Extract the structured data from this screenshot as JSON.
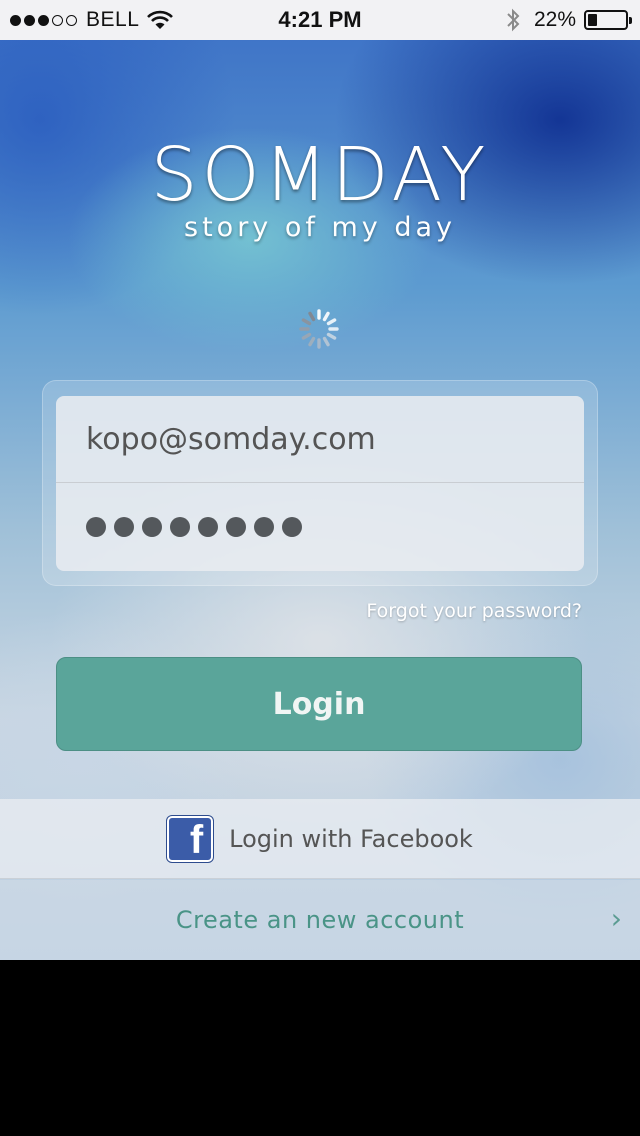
{
  "status_bar": {
    "carrier": "BELL",
    "time": "4:21 PM",
    "battery_percent": "22%",
    "signal_bars_filled": 3,
    "signal_bars_total": 5,
    "battery_level": 0.22
  },
  "brand": {
    "logo": "SOMDAY",
    "tagline": "story of my day"
  },
  "form": {
    "email_value": "kopo@somday.com",
    "password_length": 8,
    "forgot_link": "Forgot your password?",
    "login_button": "Login"
  },
  "social": {
    "facebook_label": "Login with Facebook",
    "facebook_glyph": "f"
  },
  "signup": {
    "create_account_label": "Create an new account",
    "chevron": "›"
  },
  "colors": {
    "login_button": "#5aa59a",
    "accent_text": "#4a9487",
    "facebook_blue": "#3b5ca8"
  }
}
